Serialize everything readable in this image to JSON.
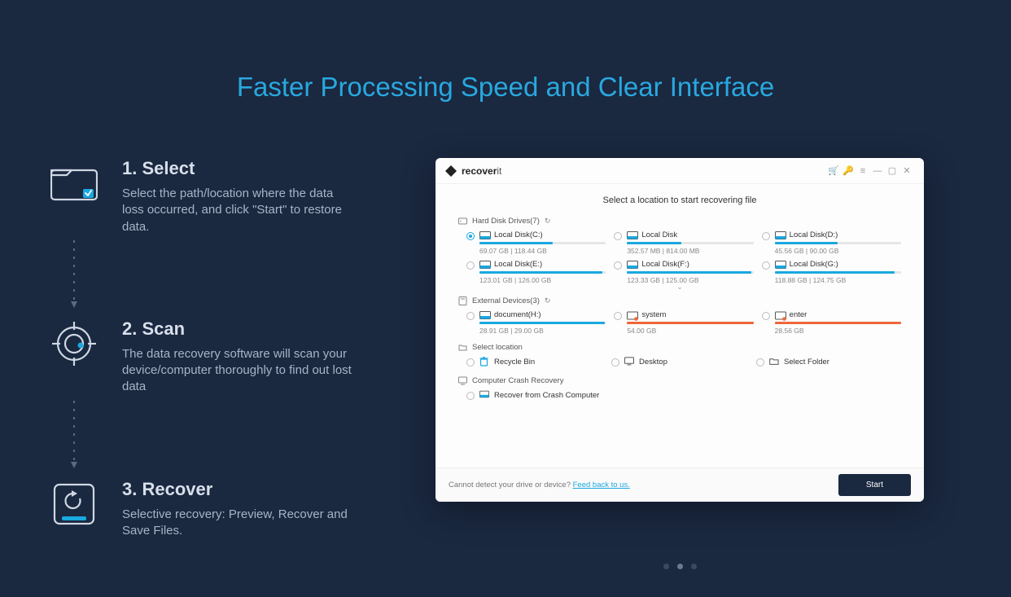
{
  "title": "Faster Processing Speed and Clear Interface",
  "steps": [
    {
      "title": "1. Select",
      "desc": "Select the path/location where the data loss occurred, and click \"Start\" to restore data."
    },
    {
      "title": "2. Scan",
      "desc": "The data recovery software will scan your device/computer thoroughly to find out lost data"
    },
    {
      "title": "3. Recover",
      "desc": "Selective recovery: Preview, Recover and Save Files."
    }
  ],
  "app": {
    "brand": "recover",
    "brand_suffix": "it",
    "heading": "Select a location to start recovering file",
    "sections": {
      "hdd": {
        "label": "Hard Disk Drives(7)",
        "refresh": "↻"
      },
      "ext": {
        "label": "External Devices(3)",
        "refresh": "↻"
      },
      "loc": {
        "label": "Select location"
      },
      "crash": {
        "label": "Computer Crash Recovery"
      }
    },
    "hdd": [
      {
        "name": "Local Disk(C:)",
        "stats": "69.07  GB | 118.44  GB",
        "fill": 58,
        "selected": true,
        "color": "blue"
      },
      {
        "name": "Local Disk",
        "stats": "352.57  MB | 814.00  MB",
        "fill": 43,
        "selected": false,
        "color": "blue"
      },
      {
        "name": "Local Disk(D:)",
        "stats": "45.56  GB | 90.00  GB",
        "fill": 50,
        "selected": false,
        "color": "blue"
      },
      {
        "name": "Local Disk(E:)",
        "stats": "123.01  GB | 126.00  GB",
        "fill": 97,
        "selected": false,
        "color": "blue"
      },
      {
        "name": "Local Disk(F:)",
        "stats": "123.33  GB | 125.00  GB",
        "fill": 98,
        "selected": false,
        "color": "blue"
      },
      {
        "name": "Local Disk(G:)",
        "stats": "118.88  GB | 124.75  GB",
        "fill": 95,
        "selected": false,
        "color": "blue"
      }
    ],
    "ext": [
      {
        "name": "document(H:)",
        "stats": "28.91  GB | 29.00  GB",
        "fill": 99,
        "color": "blue",
        "icon": "disk"
      },
      {
        "name": "system",
        "stats": "54.00  GB",
        "fill": 100,
        "color": "orange",
        "icon": "warn"
      },
      {
        "name": "enter",
        "stats": "28.56  GB",
        "fill": 100,
        "color": "orange",
        "icon": "warn"
      }
    ],
    "locations": [
      {
        "name": "Recycle Bin",
        "icon": "trash"
      },
      {
        "name": "Desktop",
        "icon": "desktop"
      },
      {
        "name": "Select Folder",
        "icon": "folder"
      }
    ],
    "crash_item": "Recover from Crash Computer",
    "footer_text": "Cannot detect your drive or device? ",
    "footer_link": "Feed back to us.",
    "start": "Start"
  },
  "dots": {
    "count": 3,
    "active": 1
  }
}
